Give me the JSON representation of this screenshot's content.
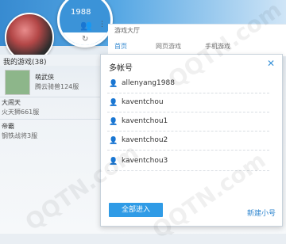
{
  "header": {
    "lens_username": "1988",
    "hall_title": "游戏大厅",
    "tabs": [
      "首页",
      "网页游戏",
      "手机游戏"
    ]
  },
  "left": {
    "my_games_label": "我的游戏(38)",
    "rows": [
      {
        "name": "萌武侠",
        "sub": "腾云骑兽124服"
      },
      {
        "name": "大闹天",
        "sub": "火天狮661服"
      },
      {
        "name": "帝霸",
        "sub": "钢铁战将3服"
      }
    ]
  },
  "popup": {
    "title": "多帐号",
    "accounts": [
      "allenyang1988",
      "kaventchou",
      "kaventchou1",
      "kaventchou2",
      "kaventchou3"
    ],
    "enter_all": "全部进入",
    "new_account": "新建小号"
  },
  "colors": {
    "accent": "#2f9be6",
    "link": "#2f86cf"
  },
  "watermark": "QQTN.com"
}
